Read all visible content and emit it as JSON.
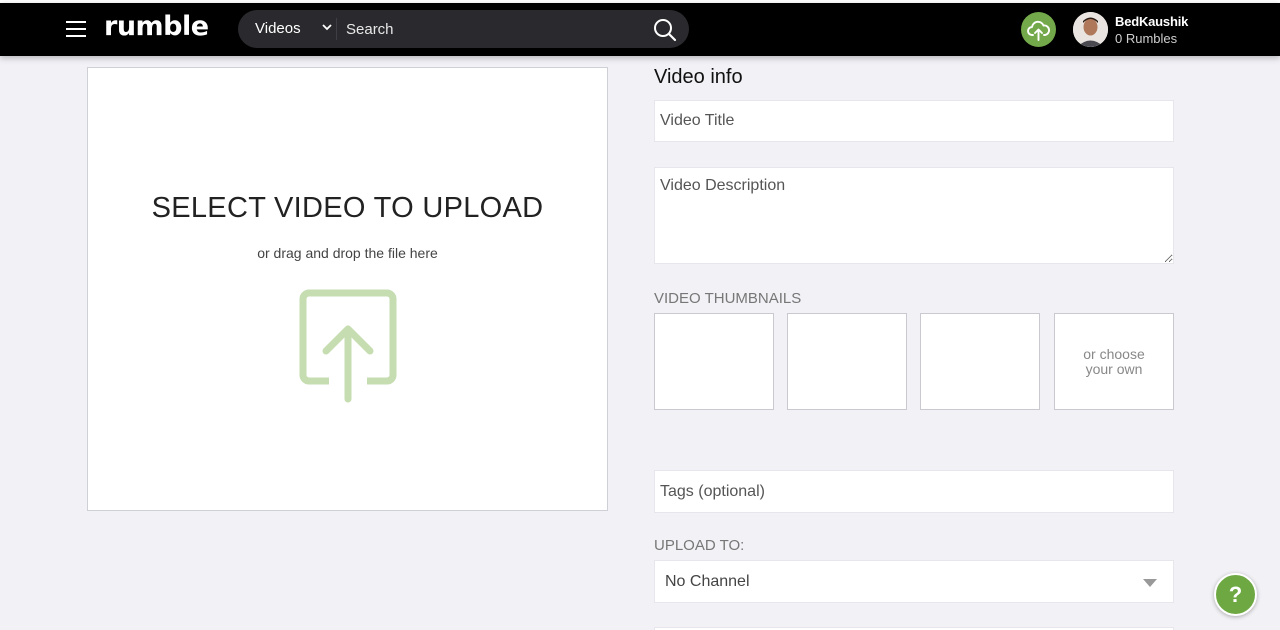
{
  "header": {
    "logo": "rumble",
    "search": {
      "category": "Videos",
      "placeholder": "Search"
    },
    "user": {
      "name": "BedKaushik",
      "rumbles": "0 Rumbles"
    }
  },
  "upload_area": {
    "title": "SELECT VIDEO TO UPLOAD",
    "subtitle": "or drag and drop the file here"
  },
  "video_info": {
    "heading": "Video info",
    "title_placeholder": "Video Title",
    "description_placeholder": "Video Description",
    "thumbnails_label": "VIDEO THUMBNAILS",
    "choose_own": "or choose your own",
    "tags_placeholder": "Tags (optional)",
    "upload_to_label": "UPLOAD TO:",
    "channel_selected": "No Channel"
  },
  "help": {
    "label": "?"
  },
  "colors": {
    "accent_green": "#74a94b",
    "upload_icon_green": "#c5ddb0",
    "header_bg": "#000000",
    "page_bg": "#f1f1f6"
  }
}
